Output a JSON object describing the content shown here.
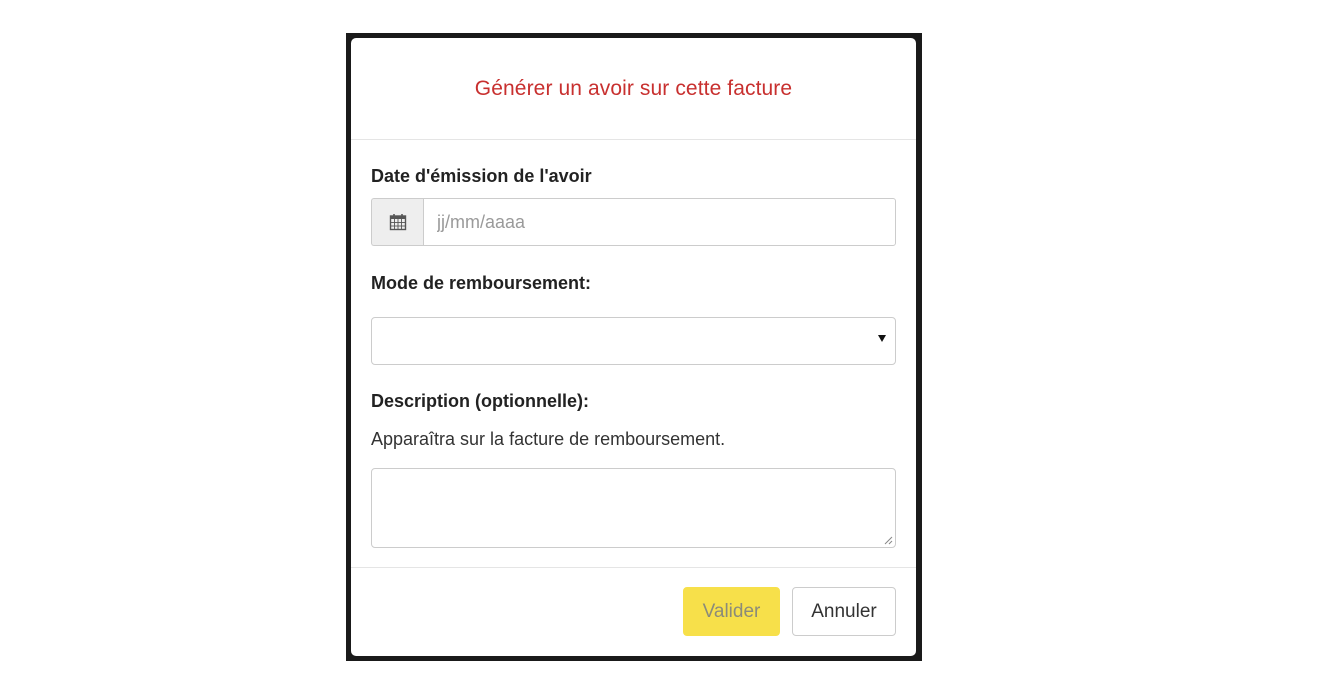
{
  "modal": {
    "title": "Générer un avoir sur cette facture"
  },
  "date_field": {
    "label": "Date d'émission de l'avoir",
    "icon": "calendar-icon",
    "placeholder": "jj/mm/aaaa",
    "value": ""
  },
  "refund_mode": {
    "label": "Mode de remboursement:",
    "selected": ""
  },
  "description": {
    "label": "Description (optionnelle):",
    "help": "Apparaîtra sur la facture de remboursement.",
    "value": ""
  },
  "footer": {
    "validate_label": "Valider",
    "cancel_label": "Annuler"
  },
  "colors": {
    "title": "#c8302f",
    "primary_button": "#f7e04a"
  }
}
